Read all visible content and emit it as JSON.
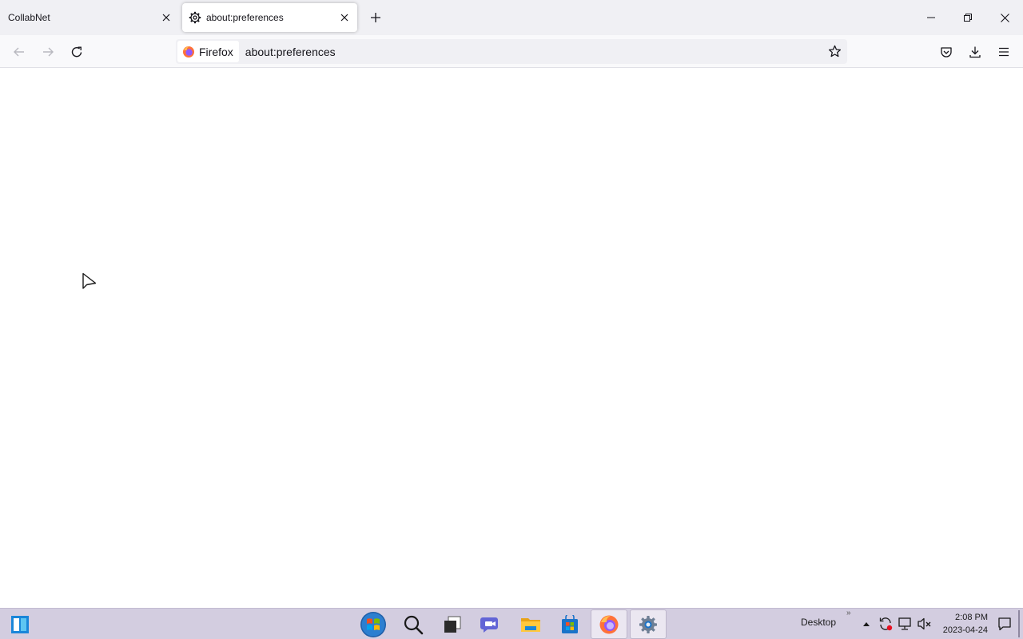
{
  "browser": {
    "tabs": [
      {
        "label": "CollabNet",
        "active": false
      },
      {
        "label": "about:preferences",
        "active": true,
        "icon": "gear-icon"
      }
    ],
    "identity_label": "Firefox",
    "url": "about:preferences"
  },
  "taskbar": {
    "desktop_label": "Desktop",
    "desktop_chevron": "»",
    "clock_time": "2:08 PM",
    "clock_date": "2023-04-24",
    "pinned": [
      "widgets-icon",
      "windows-start-icon",
      "search-icon",
      "task-view-icon",
      "teams-chat-icon",
      "file-explorer-icon",
      "microsoft-store-icon",
      "firefox-icon",
      "settings-icon"
    ]
  },
  "colors": {
    "tabstrip_bg": "#f0f0f4",
    "navbar_bg": "#f9f9fb",
    "urlbar_bg": "#f0f0f4",
    "taskbar_bg": "#d3cde0"
  }
}
